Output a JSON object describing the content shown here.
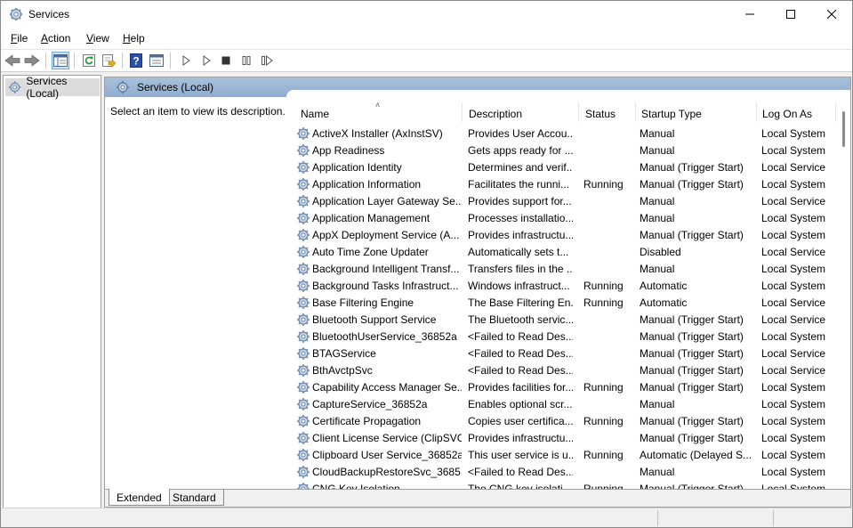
{
  "window": {
    "title": "Services",
    "controls": {
      "minimize": "minimize",
      "maximize": "maximize",
      "close": "close"
    }
  },
  "menu": [
    "File",
    "Action",
    "View",
    "Help"
  ],
  "menu_accel": [
    "F",
    "A",
    "V",
    "H"
  ],
  "toolbar": {
    "buttons": [
      "back-arrow-icon",
      "forward-arrow-icon",
      "show-hide-console-tree-icon",
      "refresh-icon",
      "export-list-icon",
      "help-icon",
      "properties-icon",
      "start-service-icon",
      "start-service-alt-icon",
      "stop-service-icon",
      "pause-service-icon",
      "restart-service-icon"
    ]
  },
  "tree": {
    "selected_label": "Services (Local)"
  },
  "pane": {
    "header": "Services (Local)",
    "description_prompt": "Select an item to view its description."
  },
  "table": {
    "columns": [
      "Name",
      "Description",
      "Status",
      "Startup Type",
      "Log On As"
    ],
    "sorted_column": "Name",
    "rows": [
      {
        "name": "ActiveX Installer (AxInstSV)",
        "desc": "Provides User Accou...",
        "status": "",
        "startup": "Manual",
        "logon": "Local System"
      },
      {
        "name": "App Readiness",
        "desc": "Gets apps ready for ...",
        "status": "",
        "startup": "Manual",
        "logon": "Local System"
      },
      {
        "name": "Application Identity",
        "desc": "Determines and verif...",
        "status": "",
        "startup": "Manual (Trigger Start)",
        "logon": "Local Service"
      },
      {
        "name": "Application Information",
        "desc": "Facilitates the runni...",
        "status": "Running",
        "startup": "Manual (Trigger Start)",
        "logon": "Local System"
      },
      {
        "name": "Application Layer Gateway Se...",
        "desc": "Provides support for...",
        "status": "",
        "startup": "Manual",
        "logon": "Local Service"
      },
      {
        "name": "Application Management",
        "desc": "Processes installatio...",
        "status": "",
        "startup": "Manual",
        "logon": "Local System"
      },
      {
        "name": "AppX Deployment Service (A...",
        "desc": "Provides infrastructu...",
        "status": "",
        "startup": "Manual (Trigger Start)",
        "logon": "Local System"
      },
      {
        "name": "Auto Time Zone Updater",
        "desc": "Automatically sets t...",
        "status": "",
        "startup": "Disabled",
        "logon": "Local Service"
      },
      {
        "name": "Background Intelligent Transf...",
        "desc": "Transfers files in the ...",
        "status": "",
        "startup": "Manual",
        "logon": "Local System"
      },
      {
        "name": "Background Tasks Infrastruct...",
        "desc": "Windows infrastruct...",
        "status": "Running",
        "startup": "Automatic",
        "logon": "Local System"
      },
      {
        "name": "Base Filtering Engine",
        "desc": "The Base Filtering En...",
        "status": "Running",
        "startup": "Automatic",
        "logon": "Local Service"
      },
      {
        "name": "Bluetooth Support Service",
        "desc": "The Bluetooth servic...",
        "status": "",
        "startup": "Manual (Trigger Start)",
        "logon": "Local Service"
      },
      {
        "name": "BluetoothUserService_36852a",
        "desc": "<Failed to Read Des...",
        "status": "",
        "startup": "Manual (Trigger Start)",
        "logon": "Local System"
      },
      {
        "name": "BTAGService",
        "desc": "<Failed to Read Des...",
        "status": "",
        "startup": "Manual (Trigger Start)",
        "logon": "Local Service"
      },
      {
        "name": "BthAvctpSvc",
        "desc": "<Failed to Read Des...",
        "status": "",
        "startup": "Manual (Trigger Start)",
        "logon": "Local Service"
      },
      {
        "name": "Capability Access Manager Se...",
        "desc": "Provides facilities for...",
        "status": "Running",
        "startup": "Manual (Trigger Start)",
        "logon": "Local System"
      },
      {
        "name": "CaptureService_36852a",
        "desc": "Enables optional scr...",
        "status": "",
        "startup": "Manual",
        "logon": "Local System"
      },
      {
        "name": "Certificate Propagation",
        "desc": "Copies user certifica...",
        "status": "Running",
        "startup": "Manual (Trigger Start)",
        "logon": "Local System"
      },
      {
        "name": "Client License Service (ClipSVC)",
        "desc": "Provides infrastructu...",
        "status": "",
        "startup": "Manual (Trigger Start)",
        "logon": "Local System"
      },
      {
        "name": "Clipboard User Service_36852a",
        "desc": "This user service is u...",
        "status": "Running",
        "startup": "Automatic (Delayed S...",
        "logon": "Local System"
      },
      {
        "name": "CloudBackupRestoreSvc_3685...",
        "desc": "<Failed to Read Des...",
        "status": "",
        "startup": "Manual",
        "logon": "Local System"
      },
      {
        "name": "CNG Key Isolation",
        "desc": "The CNG key isolati...",
        "status": "Running",
        "startup": "Manual (Trigger Start)",
        "logon": "Local System"
      }
    ]
  },
  "tabs": [
    "Extended",
    "Standard"
  ],
  "active_tab": "Extended",
  "colors": {
    "pane_header": "#9fb8d8",
    "tree_selected": "#dcdcdc"
  }
}
